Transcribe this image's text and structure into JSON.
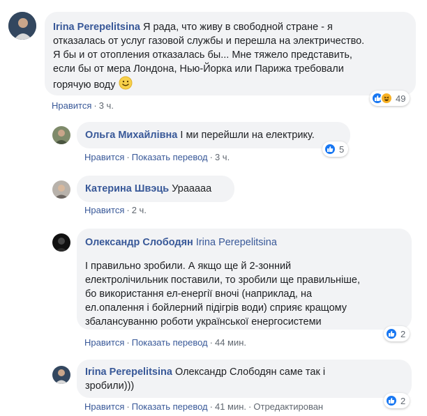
{
  "comments": [
    {
      "author": "Irina Perepelitsina",
      "text_lines": [
        "Я рада, что живу в свободной стране - я",
        "отказалась от услуг газовой службы и перешла на электричество.",
        "Я бы и от отопления отказалась бы... Мне тяжело представить,",
        "если бы от мера Лондона, Нью-Йорка или Парижа требовали",
        "горячую воду"
      ],
      "emoji": "smiley-emoji",
      "actions": {
        "like": "Нравится",
        "time": "3 ч."
      },
      "reactions": {
        "count": "49",
        "icons": [
          "like-icon",
          "haha-icon"
        ]
      }
    },
    {
      "author": "Ольга Михайлівна",
      "text": "І ми перейшли на електрику.",
      "actions": {
        "like": "Нравится",
        "translate": "Показать перевод",
        "time": "3 ч."
      },
      "reactions": {
        "count": "5",
        "icons": [
          "like-icon"
        ]
      }
    },
    {
      "author": "Катерина Швэць",
      "text": "Урааааа",
      "actions": {
        "like": "Нравится",
        "time": "2 ч."
      }
    },
    {
      "author": "Олександр Слободян",
      "mention": "Irina Perepelitsina",
      "text_lines": [
        "І правильно зробили. А якщо ще й 2-зонний",
        "електролічильник поставили, то зробили ще правильніше,",
        "бо використання ел-енергії вночі (наприклад, на",
        "ел.опалення і бойлерний підігрів води) сприяє кращому",
        "збалансуванню роботи української енергосистеми"
      ],
      "actions": {
        "like": "Нравится",
        "translate": "Показать перевод",
        "time": "44 мин."
      },
      "reactions": {
        "count": "2",
        "icons": [
          "like-icon"
        ]
      }
    },
    {
      "author": "Irina Perepelitsina",
      "text_lines": [
        "Олександр Слободян саме так і",
        "зробили)))"
      ],
      "actions": {
        "like": "Нравится",
        "translate": "Показать перевод",
        "time": "41 мин.",
        "edited": "Отредактирован"
      },
      "reactions": {
        "count": "2",
        "icons": [
          "like-icon"
        ]
      }
    }
  ],
  "colors": {
    "author": "#385898",
    "bubble": "#f2f3f5",
    "meta": "#606770",
    "like": "#1877f2",
    "haha": "#f7b125"
  }
}
